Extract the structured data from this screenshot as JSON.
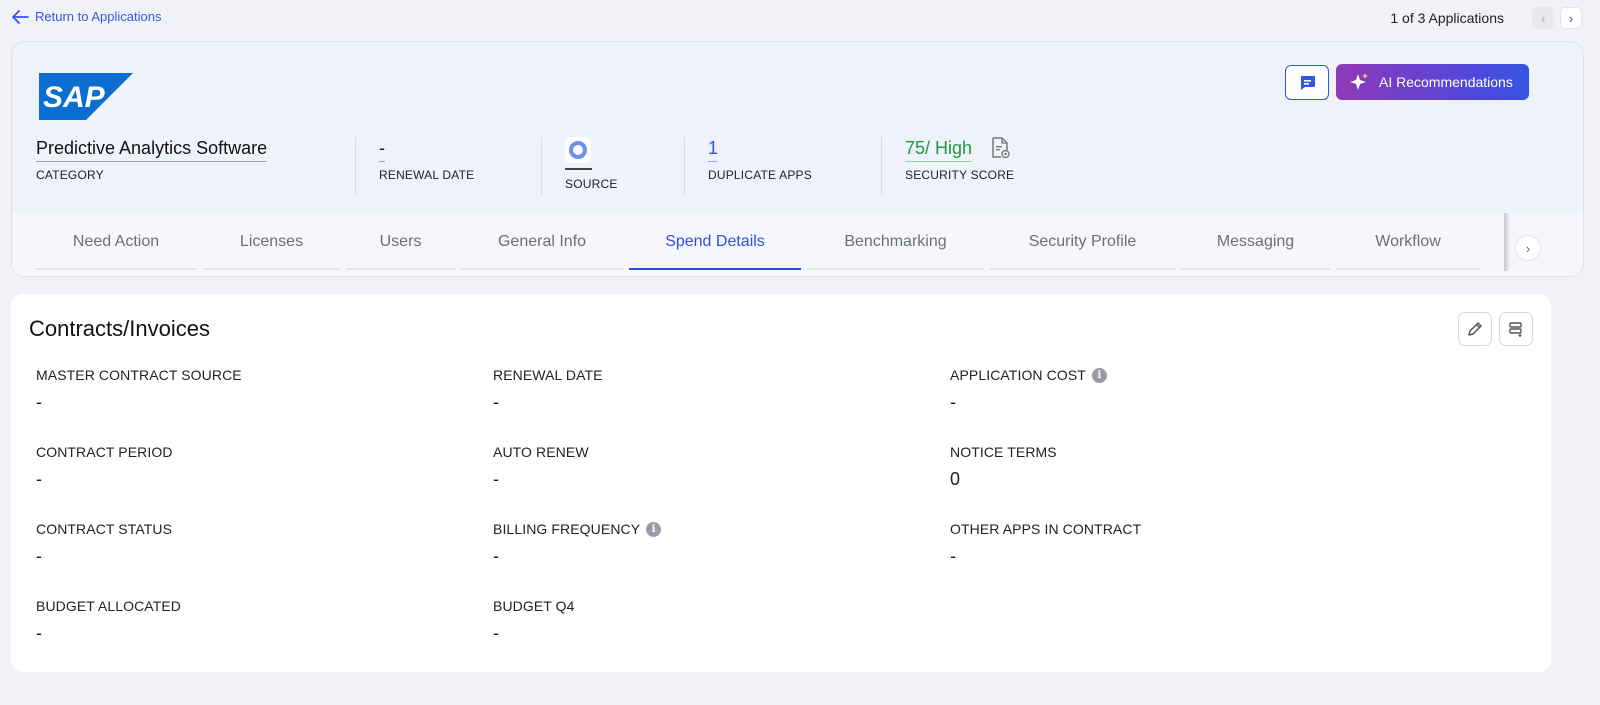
{
  "topbar": {
    "back_label": "Return to Applications",
    "pager_text": "1 of 3 Applications"
  },
  "header": {
    "logo_text": "SAP",
    "ai_button_label": "AI Recommendations",
    "meta": {
      "category": {
        "value": "Predictive Analytics Software",
        "label": "CATEGORY"
      },
      "renewal_date": {
        "value": "-",
        "label": "RENEWAL DATE"
      },
      "source": {
        "label": "SOURCE"
      },
      "duplicate_apps": {
        "value": "1",
        "label": "DUPLICATE APPS"
      },
      "security_score": {
        "value": "75/ High",
        "label": "SECURITY SCORE"
      }
    }
  },
  "tabs": [
    {
      "label": "Need Action"
    },
    {
      "label": "Licenses"
    },
    {
      "label": "Users"
    },
    {
      "label": "General Info"
    },
    {
      "label": "Spend Details",
      "active": true
    },
    {
      "label": "Benchmarking"
    },
    {
      "label": "Security Profile"
    },
    {
      "label": "Messaging"
    },
    {
      "label": "Workflow"
    }
  ],
  "contracts": {
    "title": "Contracts/Invoices",
    "fields": [
      {
        "label": "MASTER CONTRACT SOURCE",
        "value": "-"
      },
      {
        "label": "RENEWAL DATE",
        "value": "-"
      },
      {
        "label": "APPLICATION COST",
        "value": "-",
        "info": true
      },
      {
        "label": "CONTRACT PERIOD",
        "value": "-"
      },
      {
        "label": "AUTO RENEW",
        "value": "-"
      },
      {
        "label": "NOTICE TERMS",
        "value": "0"
      },
      {
        "label": "CONTRACT STATUS",
        "value": "-"
      },
      {
        "label": "BILLING FREQUENCY",
        "value": "-",
        "info": true
      },
      {
        "label": "OTHER APPS IN CONTRACT",
        "value": "-"
      },
      {
        "label": "BUDGET ALLOCATED",
        "value": "-"
      },
      {
        "label": "BUDGET Q4",
        "value": "-"
      }
    ]
  },
  "colors": {
    "accent": "#2c4fe0",
    "security_green": "#1e9b3c",
    "ai_gradient_start": "#8f3ab7",
    "ai_gradient_end": "#3553e3",
    "sap_blue": "#0a6ed1"
  },
  "icons": {
    "back": "arrow-left-icon",
    "pager_prev": "chevron-left-icon",
    "pager_next": "chevron-right-icon",
    "chat": "chat-icon",
    "ai": "sparkle-icon",
    "source": "source-circle-icon",
    "security": "document-shield-icon",
    "edit": "pencil-icon",
    "list": "list-add-icon",
    "info": "info-icon"
  }
}
